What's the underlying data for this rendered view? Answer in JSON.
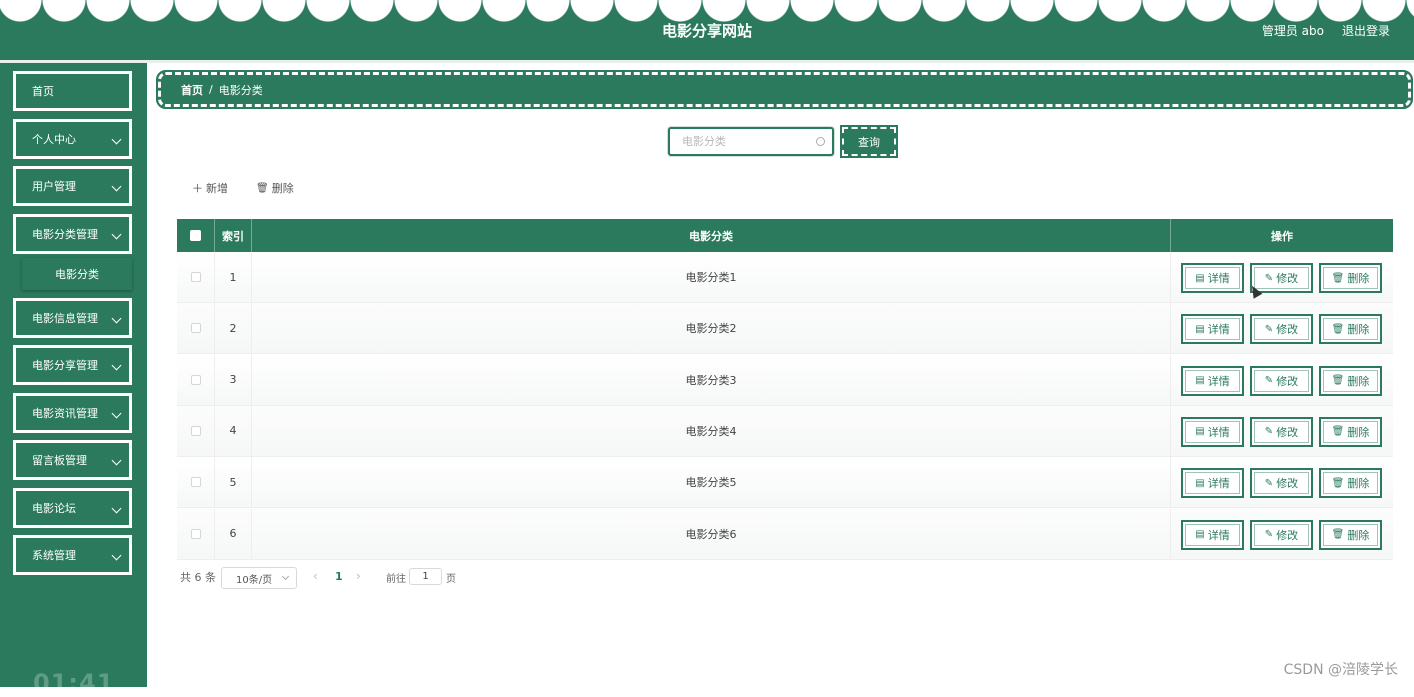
{
  "header": {
    "title": "电影分享网站",
    "user": "管理员 abo",
    "logout": "退出登录"
  },
  "sidebar": {
    "items": [
      {
        "label": "首页"
      },
      {
        "label": "个人中心"
      },
      {
        "label": "用户管理"
      },
      {
        "label": "电影分类管理"
      },
      {
        "label": "电影信息管理"
      },
      {
        "label": "电影分享管理"
      },
      {
        "label": "电影资讯管理"
      },
      {
        "label": "留言板管理"
      },
      {
        "label": "电影论坛"
      },
      {
        "label": "系统管理"
      }
    ],
    "submenu": {
      "label": "电影分类"
    },
    "clock": "01:41"
  },
  "breadcrumb": {
    "home": "首页",
    "separator": "/",
    "current": "电影分类"
  },
  "search": {
    "placeholder": "电影分类",
    "button": "查询"
  },
  "toolbar": {
    "add": "新增",
    "delete": "删除"
  },
  "table": {
    "headers": {
      "index": "索引",
      "name": "电影分类",
      "ops": "操作"
    },
    "rows": [
      {
        "index": "1",
        "name": "电影分类1"
      },
      {
        "index": "2",
        "name": "电影分类2"
      },
      {
        "index": "3",
        "name": "电影分类3"
      },
      {
        "index": "4",
        "name": "电影分类4"
      },
      {
        "index": "5",
        "name": "电影分类5"
      },
      {
        "index": "6",
        "name": "电影分类6"
      }
    ],
    "actions": {
      "detail": "详情",
      "edit": "修改",
      "delete": "删除"
    }
  },
  "pagination": {
    "total": "共 6 条",
    "page_size": "10条/页",
    "current_page": "1",
    "goto_label": "前往",
    "goto_value": "1",
    "goto_suffix": "页"
  },
  "watermark": "CSDN @涪陵学长",
  "colors": {
    "accent": "#2b7a5e"
  }
}
